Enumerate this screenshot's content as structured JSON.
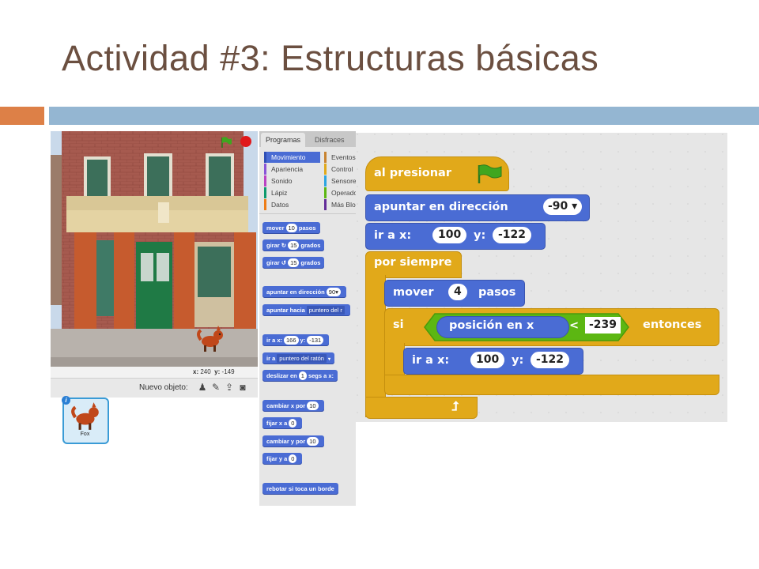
{
  "slide": {
    "title": "Actividad #3: Estructuras básicas",
    "colors": {
      "accent": "#dd8047",
      "bar": "#94b6d2",
      "title": "#6b4f40"
    }
  },
  "editor": {
    "coords": {
      "x_label": "x:",
      "x_value": "240",
      "y_label": "y:",
      "y_value": "-149"
    },
    "new_object_label": "Nuevo objeto:",
    "sprite": {
      "name": "Fox",
      "info": "i"
    },
    "palette": {
      "tabs": [
        "Programas",
        "Disfraces"
      ],
      "categories_left": [
        "Movimiento",
        "Apariencia",
        "Sonido",
        "Lápiz",
        "Datos"
      ],
      "categories_right": [
        "Eventos",
        "Control",
        "Sensores",
        "Operadores",
        "Más Bloques"
      ],
      "category_colors": {
        "Movimiento": "#4a6cd4",
        "Apariencia": "#8a55d7",
        "Sonido": "#bb42c3",
        "Lápiz": "#0e9a6c",
        "Datos": "#ee7d16",
        "Eventos": "#c88330",
        "Control": "#e1a91a",
        "Sensores": "#2ca5e2",
        "Operadores": "#5cb712",
        "Más Bloques": "#632d99"
      },
      "blocks": {
        "move": {
          "label": "mover",
          "value": "10",
          "suffix": "pasos"
        },
        "turn_right": {
          "label": "girar",
          "value": "15",
          "suffix": "grados"
        },
        "turn_left": {
          "label": "girar",
          "value": "15",
          "suffix": "grados"
        },
        "point_dir": {
          "label": "apuntar en dirección",
          "value": "90▾"
        },
        "point_toward": {
          "label": "apuntar hacia",
          "value": "puntero del r"
        },
        "goto_xy": {
          "label": "ir a x:",
          "x": "166",
          "y_label": "y:",
          "y": "-131"
        },
        "goto": {
          "label": "ir a",
          "value": "puntero del ratón"
        },
        "glide": {
          "label": "deslizar en",
          "value": "1",
          "suffix": "segs a x:"
        },
        "change_x": {
          "label": "cambiar x por",
          "value": "10"
        },
        "set_x": {
          "label": "fijar x a",
          "value": "0"
        },
        "change_y": {
          "label": "cambiar y por",
          "value": "10"
        },
        "set_y": {
          "label": "fijar y a",
          "value": "0"
        },
        "bounce": {
          "label": "rebotar si toca un borde"
        }
      }
    }
  },
  "script": {
    "hat": {
      "label": "al presionar",
      "icon": "green-flag-icon"
    },
    "point": {
      "label": "apuntar en dirección",
      "value": "-90"
    },
    "goto1": {
      "label": "ir a x:",
      "x": "100",
      "y_label": "y:",
      "y": "-122"
    },
    "forever": {
      "label": "por siempre"
    },
    "move": {
      "label": "mover",
      "value": "4",
      "suffix": "pasos"
    },
    "if": {
      "label": "si",
      "then": "entonces"
    },
    "condition": {
      "reporter": "posición en x",
      "operator": "<",
      "value": "-239"
    },
    "goto2": {
      "label": "ir a x:",
      "x": "100",
      "y_label": "y:",
      "y": "-122"
    }
  }
}
